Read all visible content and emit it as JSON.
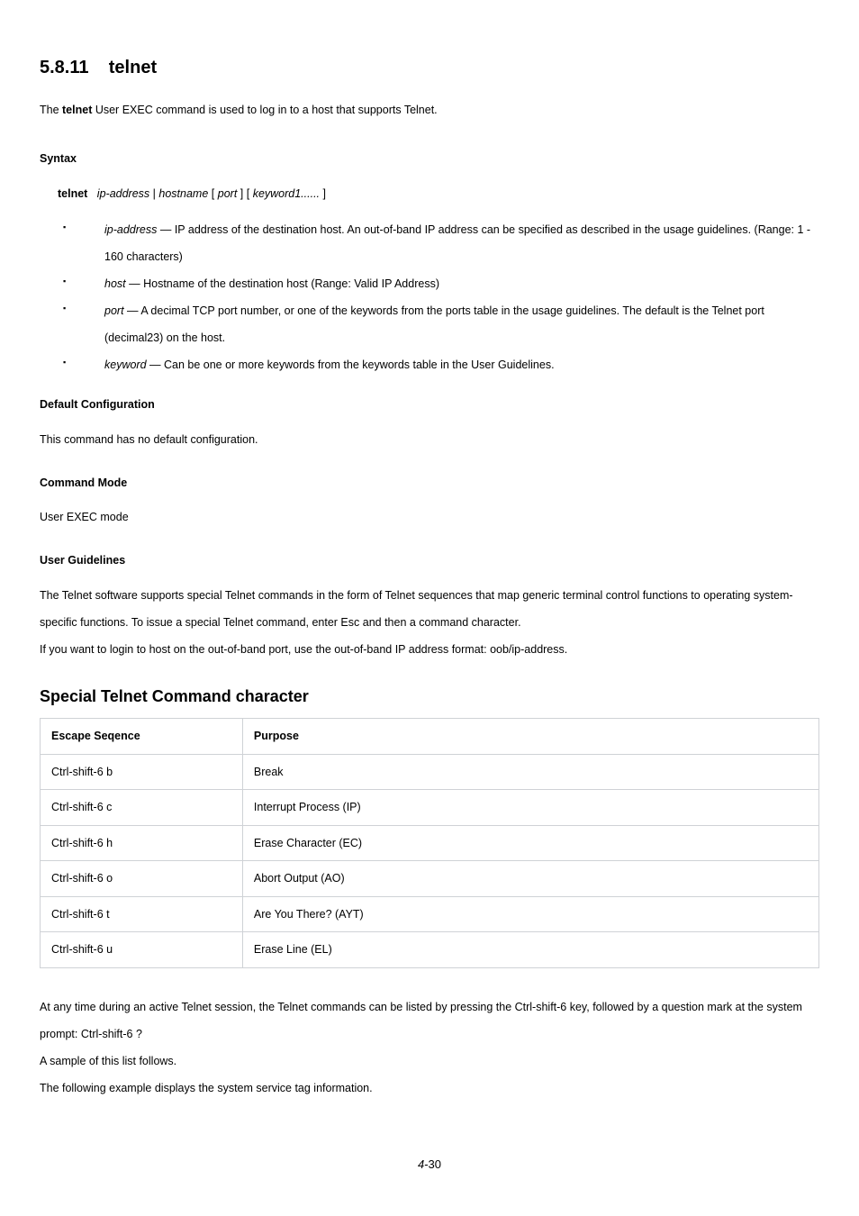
{
  "section": {
    "number": "5.8.11",
    "title": "telnet"
  },
  "intro": {
    "prefix": "The ",
    "cmd": "telnet",
    "suffix": " User EXEC command is used to log in to a host that supports Telnet."
  },
  "syntax": {
    "heading": "Syntax",
    "cmd": "telnet",
    "ip_or": "{",
    "ip": "ip-address",
    "pipe": " | ",
    "hostname": "hostname",
    "close_or": "}",
    "lbr1": " [",
    "port": "port",
    "rbr1": "] [",
    "keyword": "keyword1......",
    "rbr2": "]"
  },
  "params": [
    {
      "name": "ip-address",
      "dash": " — ",
      "desc": "IP address of the destination host. An out-of-band IP address can be specified as described in the usage guidelines. (Range: 1 - 160 characters)"
    },
    {
      "name": "host",
      "dash": " — ",
      "desc": "Hostname of the destination host (Range: Valid IP Address)"
    },
    {
      "name": "port",
      "dash": " — ",
      "desc": "A decimal TCP port number, or one of the keywords from the ports table in the usage guidelines. The default is the Telnet port (decimal23) on the host."
    },
    {
      "name": "keyword",
      "dash": " — ",
      "desc": "Can be one or more keywords from the keywords table in the User Guidelines."
    }
  ],
  "default": {
    "heading": "Default Configuration",
    "body": "This command has no default configuration."
  },
  "mode": {
    "heading": "Command Mode",
    "body": "User EXEC mode"
  },
  "guidelines": {
    "heading": "User Guidelines",
    "para1": "The Telnet software supports special Telnet commands in the form of Telnet sequences that map generic terminal control functions to operating system-specific functions. To issue a special Telnet command, enter Esc and then a command character.",
    "para2": "If you want to login to host on the out-of-band port, use the out-of-band IP address format: oob/ip-address."
  },
  "table": {
    "title": "Special Telnet Command character",
    "headers": {
      "col1": "Escape Seqence",
      "col2": "Purpose"
    },
    "rows": [
      {
        "seq": "Ctrl-shift-6 b",
        "purpose": "Break"
      },
      {
        "seq": "Ctrl-shift-6 c",
        "purpose": "Interrupt Process (IP)"
      },
      {
        "seq": "Ctrl-shift-6 h",
        "purpose": "Erase Character (EC)"
      },
      {
        "seq": "Ctrl-shift-6 o",
        "purpose": "Abort Output (AO)"
      },
      {
        "seq": "Ctrl-shift-6 t",
        "purpose": "Are You There? (AYT)"
      },
      {
        "seq": "Ctrl-shift-6 u",
        "purpose": "Erase Line (EL)"
      }
    ]
  },
  "after_table": {
    "p1": "At any time during an active Telnet session, the Telnet commands can be listed by pressing the Ctrl-shift-6 key, followed by a question mark at the system prompt: Ctrl-shift-6 ?",
    "p2": "A sample of this list follows.",
    "p3": "The following example displays the system service tag information."
  },
  "page": {
    "prefix": "4",
    "suffix": "-30"
  }
}
